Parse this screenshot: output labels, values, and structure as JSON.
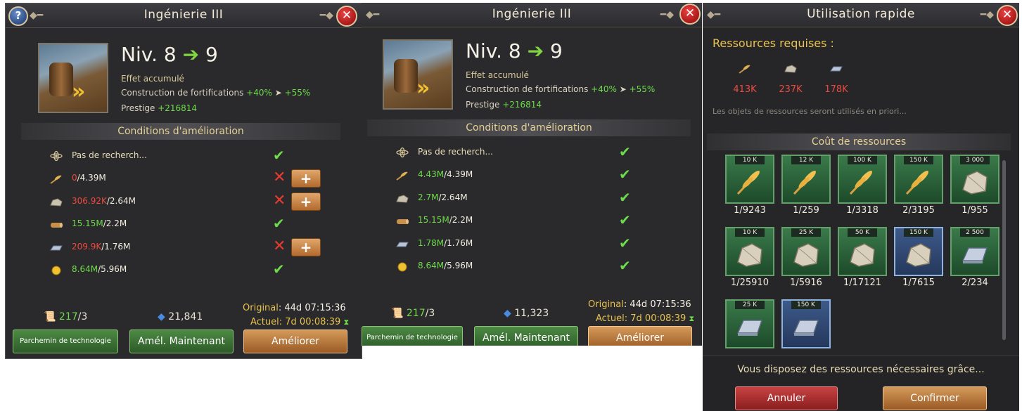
{
  "panel1": {
    "title": "Ingénierie III",
    "help_glyph": "?",
    "close_glyph": "✕",
    "level_prefix": "Niv. 8",
    "level_next": "9",
    "effect_header": "Effet accumulé",
    "effect_name": "Construction de fortifications",
    "effect_from": "+40%",
    "effect_to": "+55%",
    "prestige_label": "Prestige",
    "prestige_value": "+216814",
    "section_title": "Conditions d'amélioration",
    "conditions": [
      {
        "icon": "atom-icon",
        "have": "Pas de recherch...",
        "need": "",
        "status": "ok",
        "plus": false
      },
      {
        "icon": "food-icon",
        "have": "0",
        "need": "/4.39M",
        "status": "fail",
        "plus": true
      },
      {
        "icon": "stone-icon",
        "have": "306.92K",
        "need": "/2.64M",
        "status": "fail",
        "plus": true
      },
      {
        "icon": "wood-icon",
        "have": "15.15M",
        "need": "/2.2M",
        "status": "ok",
        "plus": false
      },
      {
        "icon": "iron-icon",
        "have": "209.9K",
        "need": "/1.76M",
        "status": "fail",
        "plus": true
      },
      {
        "icon": "gold-icon",
        "have": "8.64M",
        "need": "/5.96M",
        "status": "ok",
        "plus": false
      }
    ],
    "scroll_have": "217",
    "scroll_need": "/3",
    "gems": "21,841",
    "original_label": "Original",
    "original_value": ": 44d 07:15:36",
    "actual_label": "Actuel",
    "actual_value": ": 7d 00:08:39",
    "btn_scroll": "Parchemin de technologie",
    "btn_now": "Amél. Maintenant",
    "btn_upgrade": "Améliorer"
  },
  "panel2": {
    "title": "Ingénierie III",
    "close_glyph": "✕",
    "level_prefix": "Niv. 8",
    "level_next": "9",
    "effect_header": "Effet accumulé",
    "effect_name": "Construction de fortifications",
    "effect_from": "+40%",
    "effect_to": "+55%",
    "prestige_label": "Prestige",
    "prestige_value": "+216814",
    "section_title": "Conditions d'amélioration",
    "conditions": [
      {
        "icon": "atom-icon",
        "have": "Pas de recherch...",
        "need": "",
        "status": "ok"
      },
      {
        "icon": "food-icon",
        "have": "4.43M",
        "need": "/4.39M",
        "status": "ok"
      },
      {
        "icon": "stone-icon",
        "have": "2.7M",
        "need": "/2.64M",
        "status": "ok"
      },
      {
        "icon": "wood-icon",
        "have": "15.15M",
        "need": "/2.2M",
        "status": "ok"
      },
      {
        "icon": "iron-icon",
        "have": "1.78M",
        "need": "/1.76M",
        "status": "ok"
      },
      {
        "icon": "gold-icon",
        "have": "8.64M",
        "need": "/5.96M",
        "status": "ok"
      }
    ],
    "scroll_have": "217",
    "scroll_need": "/3",
    "gems": "11,323",
    "original_label": "Original",
    "original_value": ": 44d 07:15:36",
    "actual_label": "Actuel",
    "actual_value": ": 7d 00:08:39",
    "btn_scroll": "Parchemin de technologie",
    "btn_now": "Amél. Maintenant",
    "btn_upgrade": "Améliorer"
  },
  "panel3": {
    "title": "Utilisation rapide",
    "close_glyph": "✕",
    "required_label": "Ressources requises :",
    "required": [
      {
        "icon": "food-icon",
        "amount": "413K"
      },
      {
        "icon": "stone-icon",
        "amount": "237K"
      },
      {
        "icon": "iron-icon",
        "amount": "178K"
      }
    ],
    "priority_note": "Les objets de ressources seront utilisés en priori...",
    "cost_title": "Coût de ressources",
    "items": [
      {
        "kind": "food",
        "tag": "10 K",
        "count": "1/9243",
        "selected": false
      },
      {
        "kind": "food",
        "tag": "12 K",
        "count": "1/259",
        "selected": false
      },
      {
        "kind": "food",
        "tag": "100 K",
        "count": "1/3318",
        "selected": false
      },
      {
        "kind": "food",
        "tag": "150 K",
        "count": "2/3195",
        "selected": false
      },
      {
        "kind": "stone",
        "tag": "3 000",
        "count": "1/955",
        "selected": false
      },
      {
        "kind": "stone",
        "tag": "10 K",
        "count": "1/25910",
        "selected": false
      },
      {
        "kind": "stone",
        "tag": "25 K",
        "count": "1/5916",
        "selected": false
      },
      {
        "kind": "stone",
        "tag": "50 K",
        "count": "1/17121",
        "selected": false
      },
      {
        "kind": "stone",
        "tag": "150 K",
        "count": "1/7615",
        "selected": true
      },
      {
        "kind": "iron",
        "tag": "2 500",
        "count": "2/234",
        "selected": false
      },
      {
        "kind": "iron",
        "tag": "25 K",
        "count": "",
        "selected": false
      },
      {
        "kind": "iron",
        "tag": "150 K",
        "count": "",
        "selected": true
      }
    ],
    "footer_text": "Vous disposez des ressources nécessaires grâce...",
    "btn_cancel": "Annuler",
    "btn_confirm": "Confirmer"
  },
  "colors": {
    "accent_green": "#6edb4a",
    "warn_red": "#ec4a3e",
    "gold": "#e8c250"
  }
}
